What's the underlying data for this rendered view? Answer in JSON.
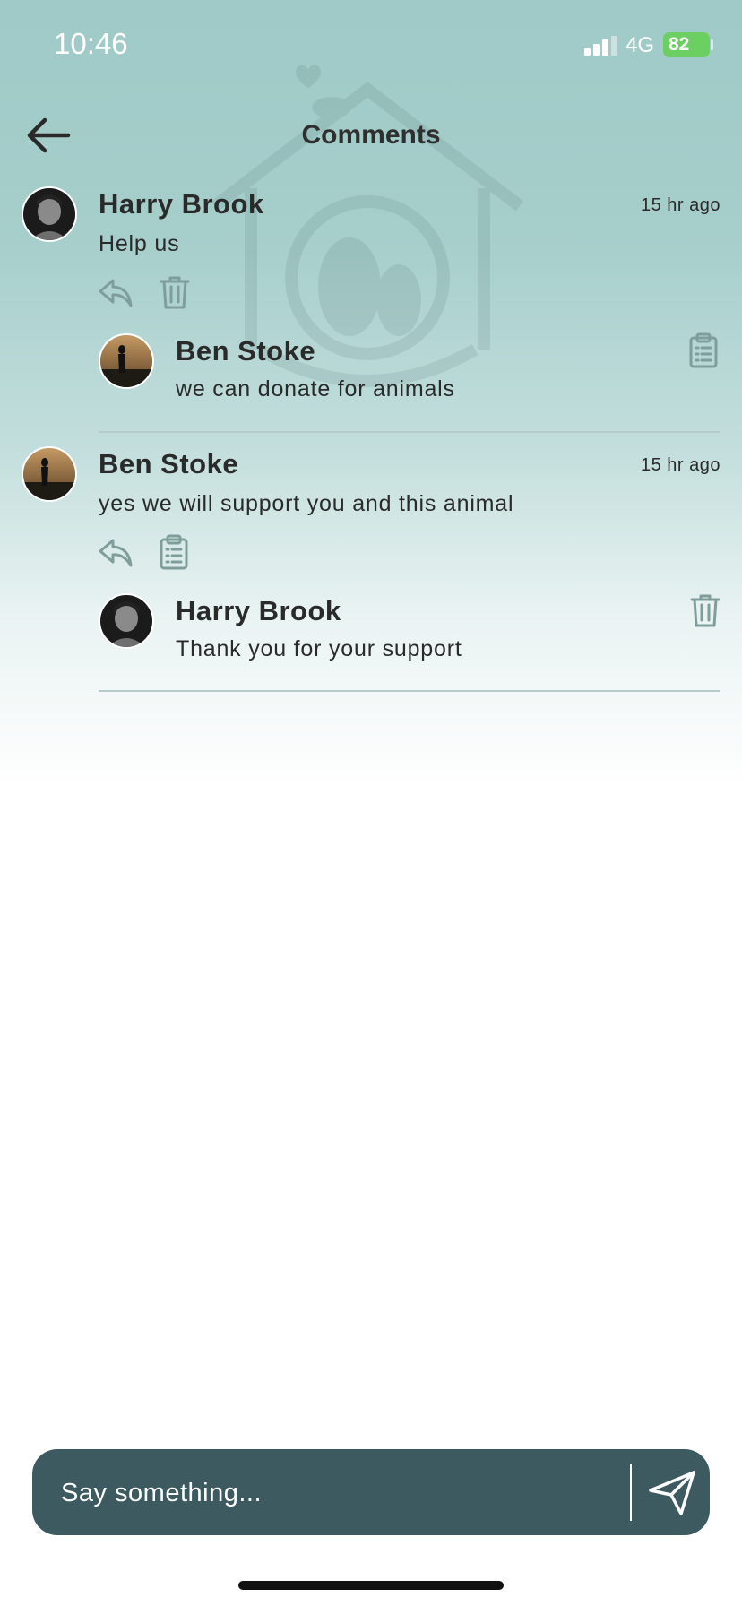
{
  "status_bar": {
    "time": "10:46",
    "network": "4G",
    "battery": "82"
  },
  "header": {
    "title": "Comments"
  },
  "comments": [
    {
      "author": "Harry Brook",
      "text": "Help us",
      "timestamp": "15 hr ago",
      "actions": [
        "reply-icon",
        "trash-icon"
      ],
      "reply": {
        "author": "Ben Stoke",
        "text": "we can donate for animals",
        "action": "clipboard-icon"
      }
    },
    {
      "author": "Ben Stoke",
      "text": "yes we will support you and this animal",
      "timestamp": "15 hr ago",
      "actions": [
        "reply-icon",
        "clipboard-icon"
      ],
      "reply": {
        "author": "Harry Brook",
        "text": "Thank you for your support",
        "action": "trash-icon"
      }
    }
  ],
  "composer": {
    "placeholder": "Say something..."
  },
  "colors": {
    "accent": "#3d5a61",
    "background_top": "#9fcac7",
    "battery": "#6bcf61",
    "icon_muted": "#7f9e9b"
  }
}
